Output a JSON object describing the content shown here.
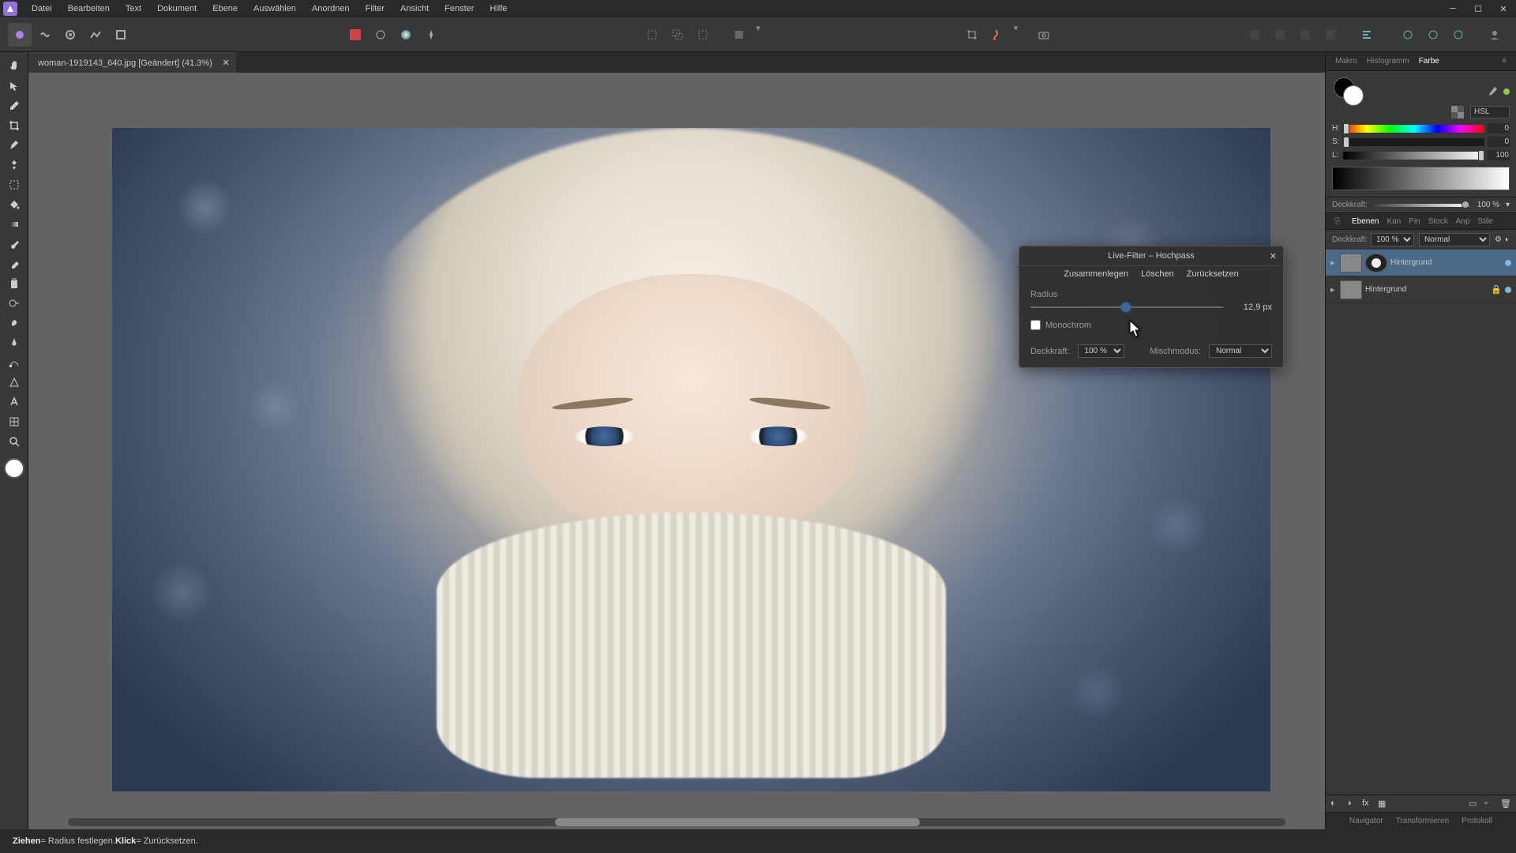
{
  "menu": [
    "Datei",
    "Bearbeiten",
    "Text",
    "Dokument",
    "Ebene",
    "Auswählen",
    "Anordnen",
    "Filter",
    "Ansicht",
    "Fenster",
    "Hilfe"
  ],
  "doc": {
    "title": "woman-1919143_640.jpg [Geändert] (41.3%)"
  },
  "dialog": {
    "title": "Live-Filter – Hochpass",
    "merge": "Zusammenlegen",
    "delete": "Löschen",
    "reset": "Zurücksetzen",
    "radius_label": "Radius",
    "radius_value": "12,9 px",
    "mono": "Monochrom",
    "opacity_label": "Deckkraft:",
    "opacity_value": "100 %",
    "blend_label": "Mischmodus:",
    "blend_value": "Normal"
  },
  "color": {
    "tabs": [
      "Makro",
      "Histogramm",
      "Farbe"
    ],
    "active": 2,
    "mode": "HSL",
    "h": {
      "label": "H:",
      "value": "0"
    },
    "s": {
      "label": "S:",
      "value": "0"
    },
    "l": {
      "label": "L:",
      "value": "100"
    }
  },
  "opacity": {
    "label": "Deckkraft:",
    "value": "100 %"
  },
  "layer_tabs": [
    "Ebenen",
    "Kan",
    "Pin",
    "Stock",
    "Anp",
    "Stile"
  ],
  "layer_tab_active": 0,
  "layer_opts": {
    "opacity_label": "Deckkraft:",
    "opacity_value": "100 %",
    "blend_value": "Normal"
  },
  "layers": [
    {
      "name": "Hintergrund",
      "selected": true,
      "is_adjustment": true
    },
    {
      "name": "Hintergrund",
      "selected": false,
      "locked": true
    }
  ],
  "bottom_tabs": [
    "Navigator",
    "Transformieren",
    "Protokoll"
  ],
  "status": {
    "drag": "Ziehen",
    "drag_desc": " = Radius festlegen. ",
    "click": "Klick",
    "click_desc": " = Zurücksetzen."
  }
}
